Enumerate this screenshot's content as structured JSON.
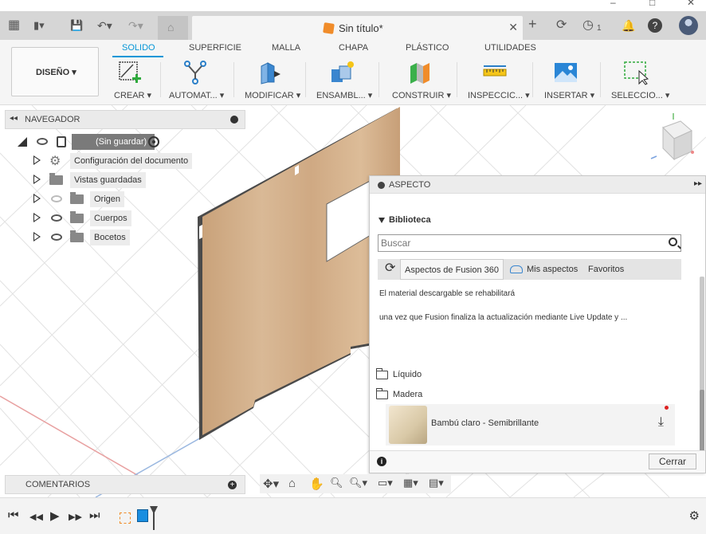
{
  "window": {
    "minimize": "–",
    "maximize": "□",
    "close": "✕"
  },
  "appbar": {
    "grid_icon": "▦",
    "file_icon": "▮▾",
    "save_icon": "💾",
    "undo_icon": "↶▾",
    "redo_icon": "↷▾",
    "home_icon": "⌂",
    "document_title": "Sin título*",
    "tab_close": "✕",
    "new_tab_icon": "+",
    "refresh_icon": "⟳",
    "jobs_icon": "◷",
    "jobs_count": "1",
    "notifications_icon": "🔔",
    "help_icon": "?",
    "avatar_icon": "●"
  },
  "ribbon": {
    "workspace": "DISEÑO ▾",
    "tabs": [
      "SOLIDO",
      "SUPERFICIE",
      "MALLA",
      "CHAPA",
      "PLÁSTICO",
      "UTILIDADES"
    ],
    "active_tab": "SOLIDO",
    "groups": [
      {
        "label": "CREAR ▾",
        "icon": "create-sketch-icon"
      },
      {
        "label": "AUTOMAT... ▾",
        "icon": "automate-icon"
      },
      {
        "label": "MODIFICAR ▾",
        "icon": "modify-icon"
      },
      {
        "label": "ENSAMBL... ▾",
        "icon": "assemble-icon"
      },
      {
        "label": "CONSTRUIR ▾",
        "icon": "construct-icon"
      },
      {
        "label": "INSPECCIC... ▾",
        "icon": "inspect-icon"
      },
      {
        "label": "INSERTAR ▾",
        "icon": "insert-icon"
      },
      {
        "label": "SELECCIO... ▾",
        "icon": "select-icon"
      }
    ]
  },
  "navigator": {
    "title": "NAVEGADOR",
    "collapse_icon": "◂◂",
    "root": "(Sin guardar)",
    "items": [
      {
        "label": "Configuración del documento",
        "icon": "gear-icon"
      },
      {
        "label": "Vistas guardadas",
        "icon": "folder-icon"
      },
      {
        "label": "Origen",
        "icon": "folder-icon"
      },
      {
        "label": "Cuerpos",
        "icon": "folder-icon"
      },
      {
        "label": "Bocetos",
        "icon": "folder-icon"
      }
    ]
  },
  "aspect": {
    "title": "ASPECTO",
    "expand_icon": "▸▸",
    "library_title": "Biblioteca",
    "search_placeholder": "Buscar",
    "segments": [
      "Aspectos de Fusion 360",
      "Mis aspectos",
      "Favoritos"
    ],
    "message_line1": "El material descargable se rehabilitará",
    "message_line2": "una vez que Fusion finaliza la actualización mediante Live Update y ...",
    "folders": [
      "Líquido",
      "Madera"
    ],
    "material": {
      "name": "Bambú claro - Semibrillante",
      "download_icon": "⤓"
    },
    "close_label": "Cerrar",
    "info_icon": "i"
  },
  "comments": {
    "title": "COMENTARIOS",
    "add_icon": "+"
  },
  "navbar": [
    "✥▾",
    "⌂",
    "✋",
    "🔍︎",
    "🔍︎▾",
    "▭▾",
    "▦▾",
    "▤▾"
  ],
  "timeline": {
    "first": "⏮",
    "prev": "◀◀",
    "play": "▶",
    "next": "▶▶",
    "last": "⏭",
    "settings": "⚙"
  }
}
